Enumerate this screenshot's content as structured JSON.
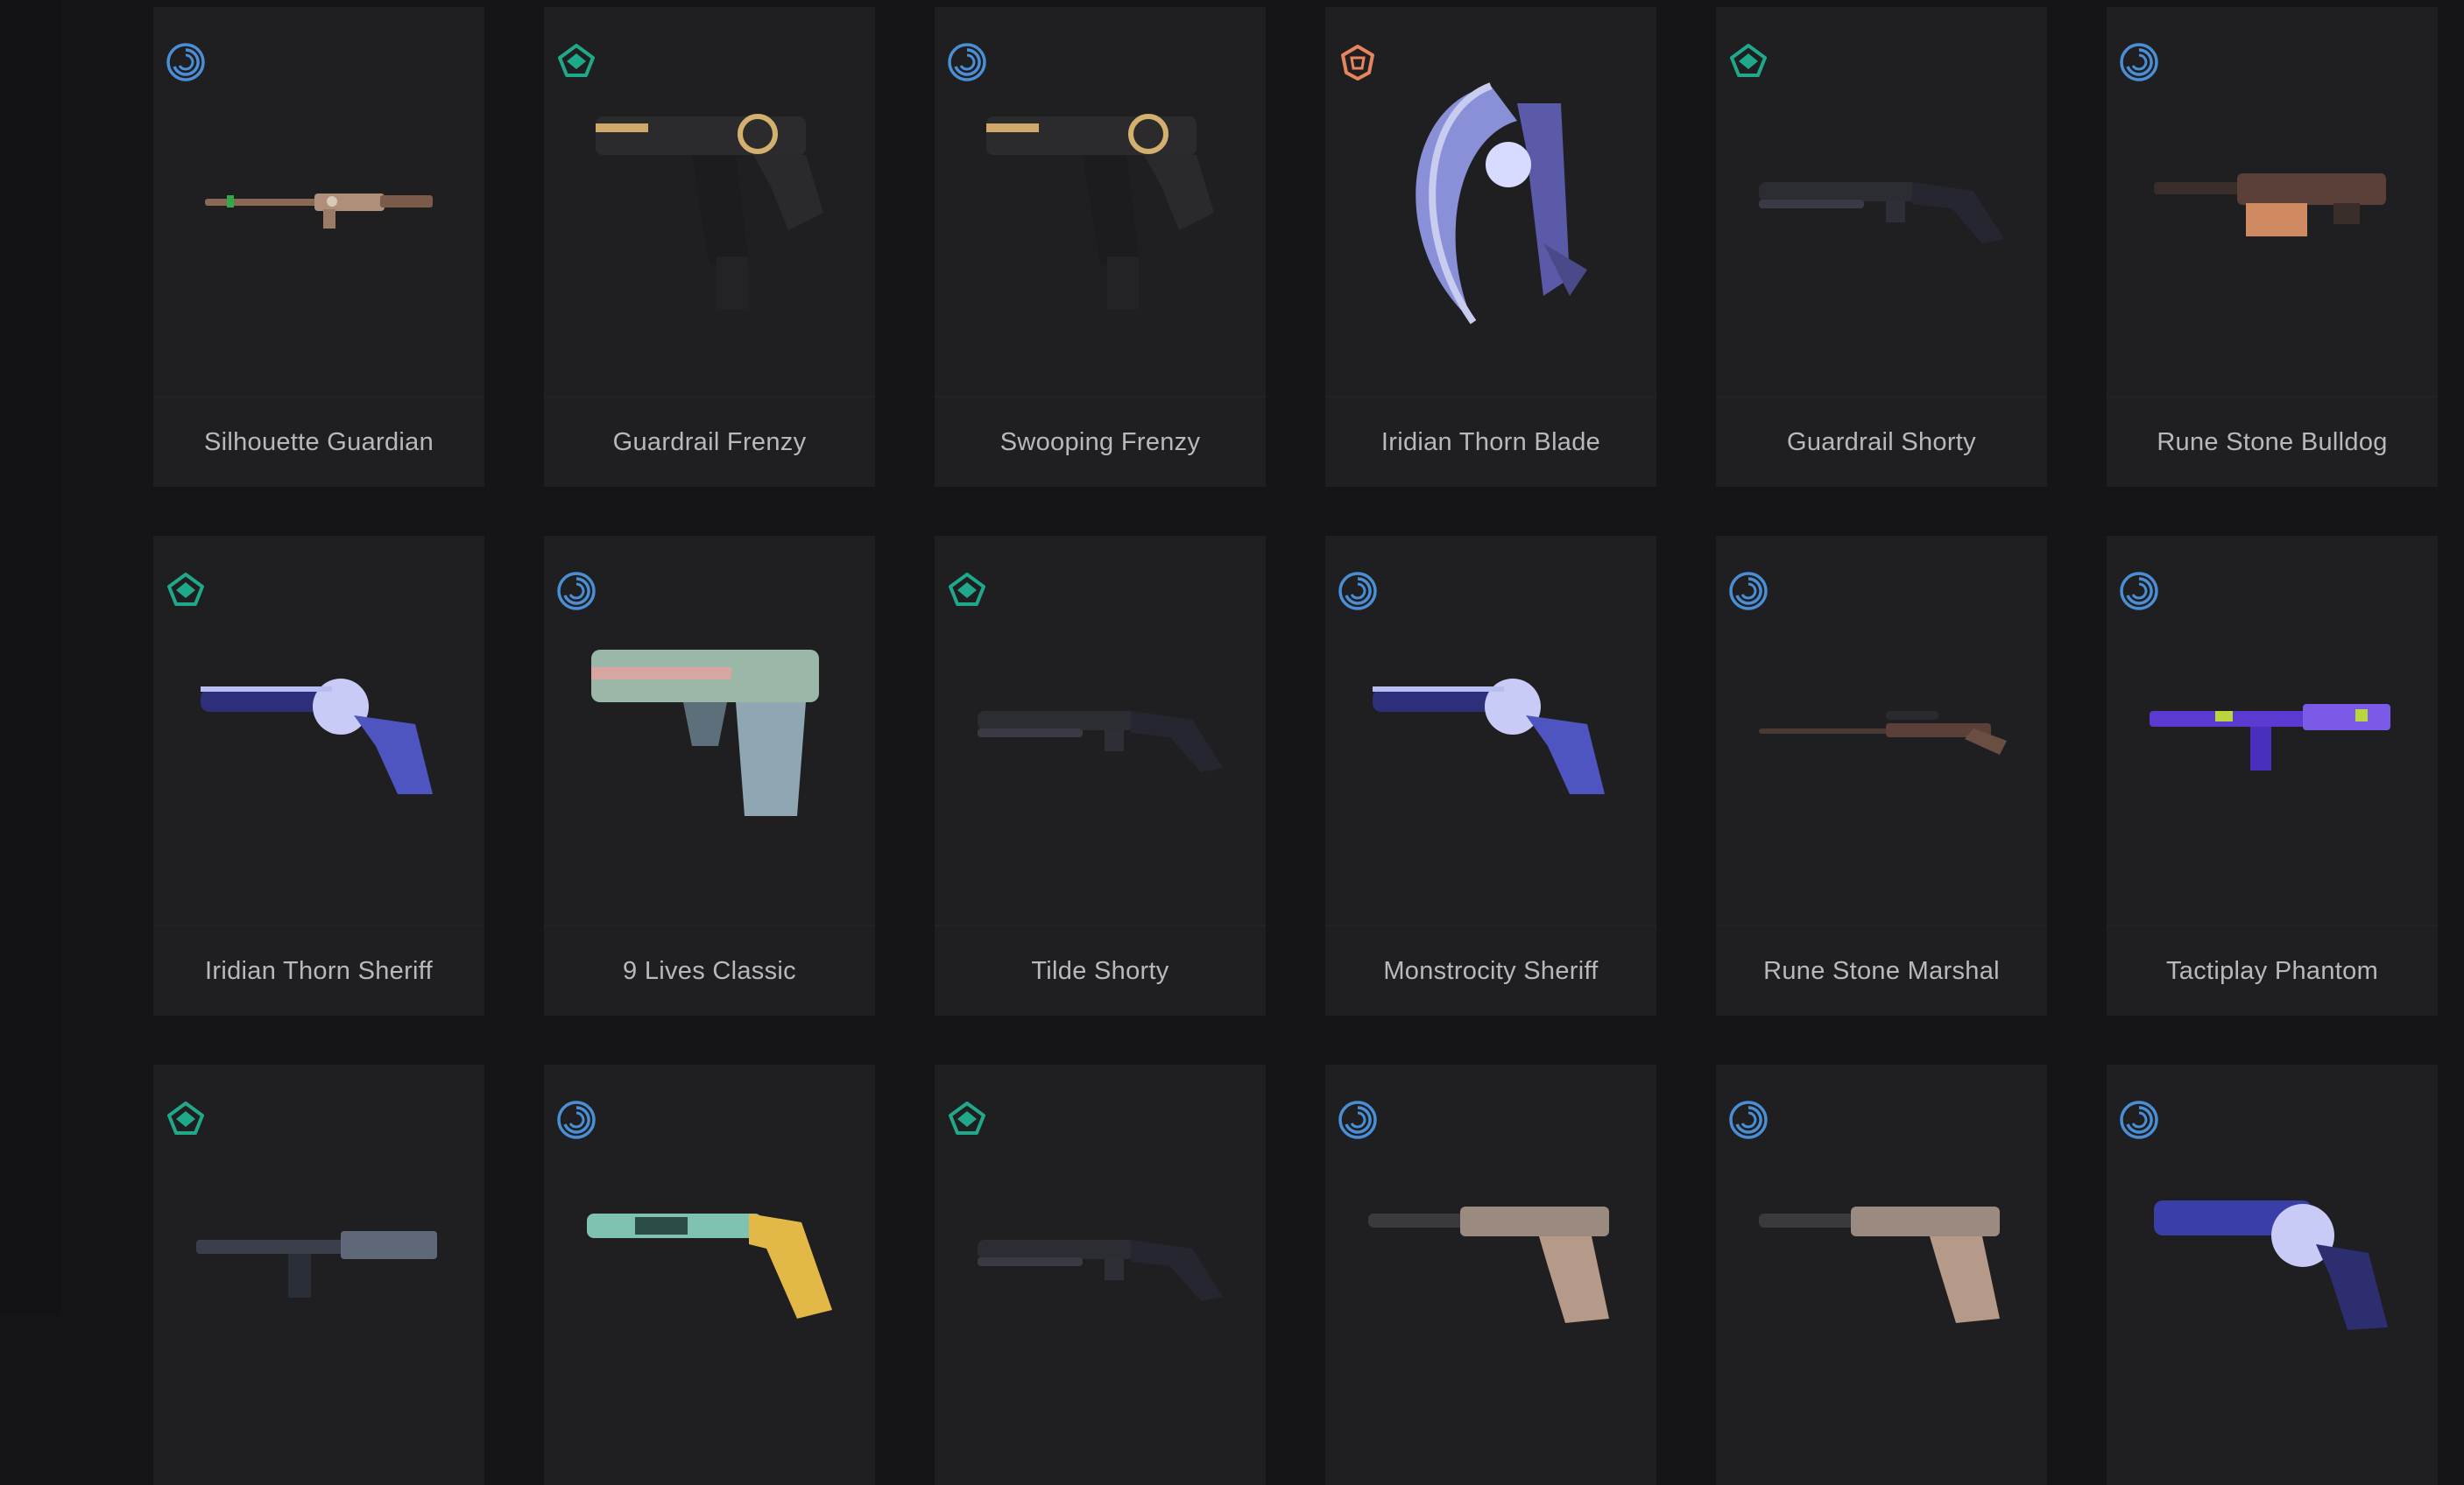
{
  "colors": {
    "background": "#151416",
    "card": "#1f1e20",
    "text": "#b9b8bb",
    "tier_select": "#4a8fd6",
    "tier_deluxe": "#1fa889",
    "tier_exclusive": "#e7865e"
  },
  "grid": {
    "rows": [
      [
        {
          "name": "Silhouette Guardian",
          "tier_icon": "select-tier-icon",
          "weapon_icon": "guardian-rifle-icon",
          "chromas": []
        },
        {
          "name": "Guardrail Frenzy",
          "tier_icon": "deluxe-tier-icon",
          "weapon_icon": "frenzy-pistol-icon",
          "chromas": []
        },
        {
          "name": "Swooping Frenzy",
          "tier_icon": "select-tier-icon",
          "weapon_icon": "frenzy-pistol-icon",
          "chromas": []
        },
        {
          "name": "Iridian Thorn Blade",
          "tier_icon": "exclusive-tier-icon",
          "weapon_icon": "melee-blade-icon",
          "chromas": []
        },
        {
          "name": "Guardrail Shorty",
          "tier_icon": "deluxe-tier-icon",
          "weapon_icon": "shorty-shotgun-icon",
          "chromas": []
        },
        {
          "name": "Rune Stone Bulldog",
          "tier_icon": "select-tier-icon",
          "weapon_icon": "bulldog-rifle-icon",
          "chromas": []
        }
      ],
      [
        {
          "name": "Iridian Thorn Sheriff",
          "tier_icon": "deluxe-tier-icon",
          "weapon_icon": "sheriff-revolver-icon",
          "chromas": []
        },
        {
          "name": "9 Lives Classic",
          "tier_icon": "select-tier-icon",
          "weapon_icon": "classic-pistol-icon",
          "chromas": [
            {
              "border": "#2fa94a",
              "fill": [
                "#3fd0d0",
                "#1c6f78"
              ]
            },
            {
              "border": "#c4303c",
              "fill": [
                "#f0a13a",
                "#b74b68"
              ]
            },
            {
              "border": "#2fa94a",
              "fill": [
                "#b58ae6",
                "#4a3da3"
              ]
            },
            {
              "border": "#c4303c",
              "fill": [
                "#7ed06b",
                "#3e6f8e"
              ]
            }
          ]
        },
        {
          "name": "Tilde Shorty",
          "tier_icon": "deluxe-tier-icon",
          "weapon_icon": "shorty-shotgun-icon",
          "chromas": [
            {
              "border": "#2fa94a",
              "fill": [
                "#c8c8e8",
                "#3a3f8f"
              ]
            },
            {
              "border": "#c4303c",
              "fill": [
                "#e63c6e",
                "#6d1436"
              ]
            },
            {
              "border": "#c4303c",
              "fill": [
                "#c9a5ff",
                "#5846c2"
              ]
            },
            {
              "border": "#c4303c",
              "fill": [
                "#c4d83c",
                "#2f9a3a"
              ]
            }
          ]
        },
        {
          "name": "Monstrocity Sheriff",
          "tier_icon": "select-tier-icon",
          "weapon_icon": "sheriff-revolver-icon",
          "chromas": [
            {
              "border": "#2fa94a",
              "fill": [
                "#f2f2f2",
                "#6a6a6a"
              ]
            },
            {
              "border": "#c4303c",
              "fill": [
                "#f7c3a5",
                "#c65a3a"
              ]
            },
            {
              "border": "#c4303c",
              "fill": [
                "#38d6f0",
                "#c13aa0"
              ]
            },
            {
              "border": "#c4303c",
              "fill": [
                "#f4e7a0",
                "#b38a2a"
              ]
            }
          ]
        },
        {
          "name": "Rune Stone Marshal",
          "tier_icon": "select-tier-icon",
          "weapon_icon": "marshal-sniper-icon",
          "chromas": []
        },
        {
          "name": "Tactiplay Phantom",
          "tier_icon": "select-tier-icon",
          "weapon_icon": "phantom-rifle-icon",
          "chromas": []
        }
      ],
      [
        {
          "name": "",
          "tier_icon": "deluxe-tier-icon",
          "weapon_icon": "rifle-icon",
          "chromas": []
        },
        {
          "name": "",
          "tier_icon": "select-tier-icon",
          "weapon_icon": "shotgun-icon",
          "chromas": []
        },
        {
          "name": "",
          "tier_icon": "deluxe-tier-icon",
          "weapon_icon": "shorty-shotgun-icon",
          "chromas": []
        },
        {
          "name": "",
          "tier_icon": "select-tier-icon",
          "weapon_icon": "suppressed-pistol-icon",
          "chromas": []
        },
        {
          "name": "",
          "tier_icon": "select-tier-icon",
          "weapon_icon": "suppressed-pistol-icon",
          "chromas": []
        },
        {
          "name": "",
          "tier_icon": "select-tier-icon",
          "weapon_icon": "revolver-icon",
          "chromas": []
        }
      ]
    ]
  }
}
